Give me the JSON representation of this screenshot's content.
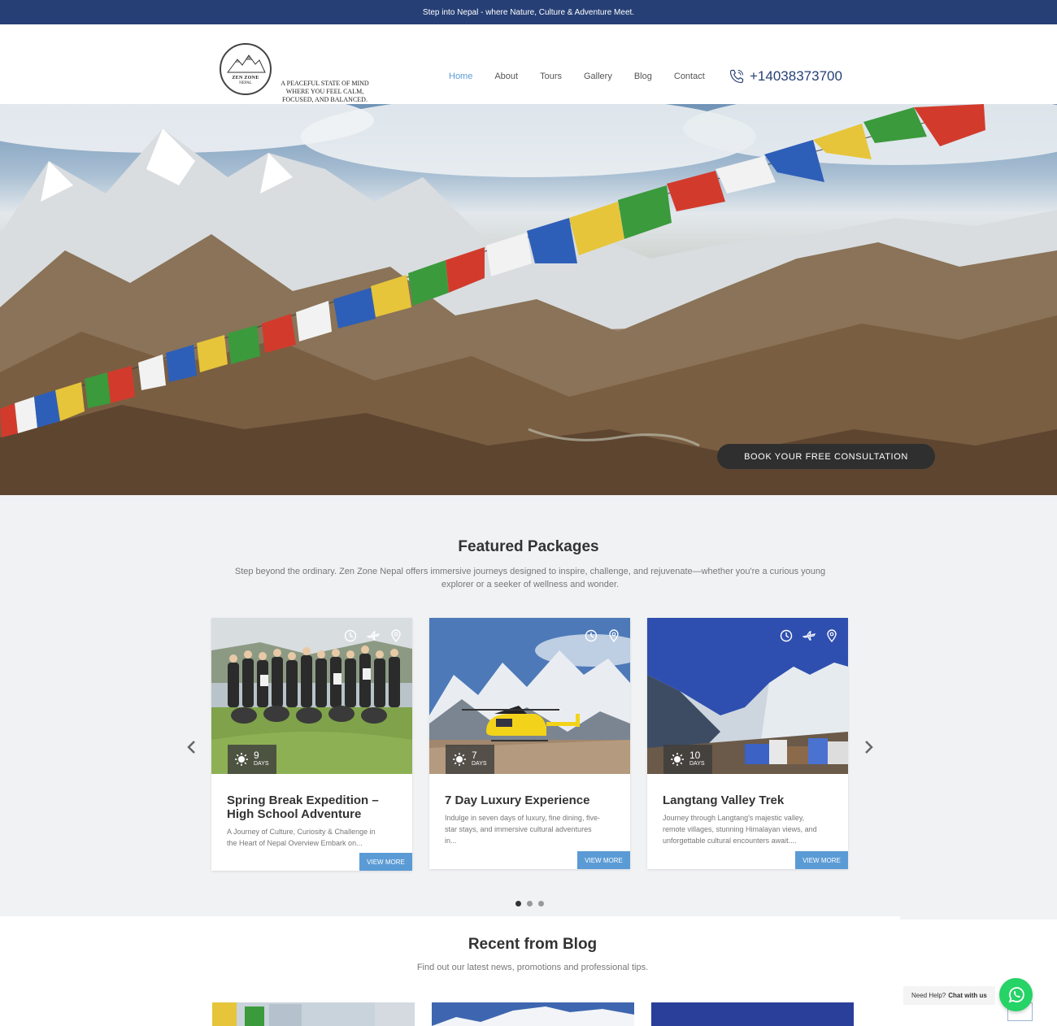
{
  "topbar": {
    "text": "Step into Nepal - where Nature, Culture & Adventure Meet."
  },
  "logo": {
    "name": "ZEN ZONE",
    "sub": "NEPAL",
    "icon": "mountain-logo-icon"
  },
  "tagline": "A peaceful state of mind where you feel calm, focused, and balanced.",
  "nav": {
    "items": [
      {
        "label": "Home",
        "active": true
      },
      {
        "label": "About"
      },
      {
        "label": "Tours"
      },
      {
        "label": "Gallery"
      },
      {
        "label": "Blog"
      },
      {
        "label": "Contact"
      }
    ],
    "phone": "+14038373700",
    "phone_icon": "phone-icon"
  },
  "hero": {
    "cta": "BOOK YOUR FREE CONSULTATION",
    "image": "himalayan-mountains-prayer-flags"
  },
  "featured": {
    "title": "Featured Packages",
    "description": "Step beyond the ordinary. Zen Zone Nepal offers immersive journeys designed to inspire, challenge, and rejuvenate—whether you're a curious young explorer or a seeker of wellness and wonder.",
    "cards": [
      {
        "days": "9",
        "days_label": "DAYS",
        "title": "Spring Break Expedition – High School Adventure",
        "text": "A Journey of Culture, Curiosity & Challenge in the Heart of Nepal Overview Embark on...",
        "button": "VIEW MORE",
        "icons": [
          "clock-icon",
          "plane-icon",
          "location-pin-icon"
        ]
      },
      {
        "days": "7",
        "days_label": "DAYS",
        "title": "7 Day Luxury Experience",
        "text": "Indulge in seven days of luxury, fine dining, five-star stays, and immersive cultural adventures in...",
        "button": "VIEW MORE",
        "icons": [
          "clock-icon",
          "location-pin-icon"
        ]
      },
      {
        "days": "10",
        "days_label": "DAYS",
        "title": "Langtang Valley Trek",
        "text": "Journey through Langtang's majestic valley, remote villages, stunning Himalayan views, and unforgettable cultural encounters await....",
        "button": "VIEW MORE",
        "icons": [
          "clock-icon",
          "plane-icon",
          "location-pin-icon"
        ]
      }
    ],
    "dots": 3,
    "active_dot": 0
  },
  "blog": {
    "title": "Recent from Blog",
    "description": "Find out our latest news, promotions and professional tips."
  },
  "chat": {
    "help": "Need Help?",
    "chat": "Chat with us",
    "icon": "whatsapp-icon"
  },
  "colors": {
    "topbar": "#263f75",
    "accent": "#5b9bd5",
    "cta": "#2f2f2f",
    "whatsapp": "#25d366"
  }
}
